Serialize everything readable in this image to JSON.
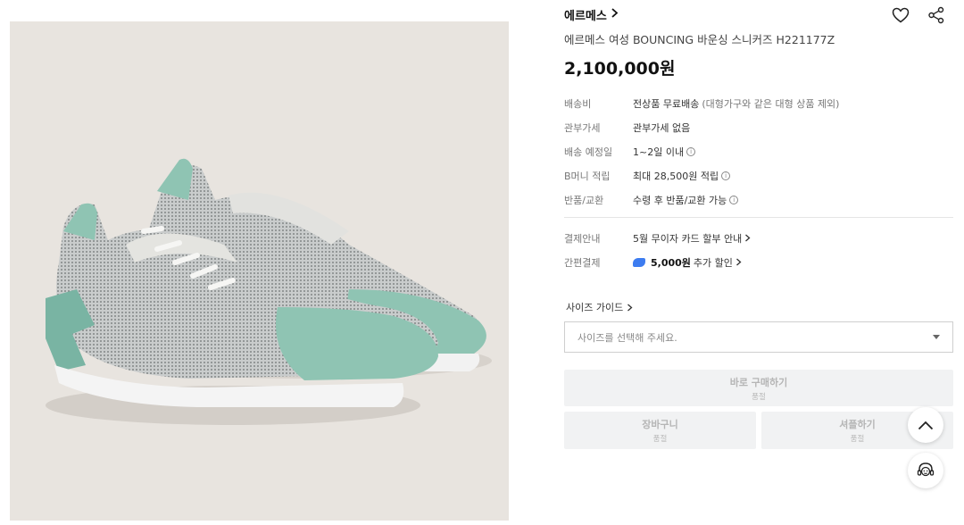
{
  "product": {
    "brand": "에르메스",
    "title": "에르메스 여성 BOUNCING 바운싱 스니커즈 H221177Z",
    "price": "2,100,000원"
  },
  "details": [
    {
      "key": "배송비",
      "value": "전상품 무료배송",
      "sub": "(대형가구와 같은 대형 상품 제외)"
    },
    {
      "key": "관부가세",
      "value": "관부가세 없음"
    },
    {
      "key": "배송 예정일",
      "value": "1~2일 이내"
    },
    {
      "key": "B머니 적립",
      "value": "최대 28,500원 적립"
    },
    {
      "key": "반품/교환",
      "value": "수령 후 반품/교환 가능"
    }
  ],
  "payment": [
    {
      "key": "결제안내",
      "value": "5월 무이자 카드 할부 안내"
    },
    {
      "key": "간편결제",
      "value_bold": "5,000원",
      "value": "추가 할인"
    }
  ],
  "size": {
    "guide_label": "사이즈 가이드",
    "placeholder": "사이즈를 선택해 주세요."
  },
  "buttons": {
    "buy_label": "바로 구매하기",
    "buy_sub": "품절",
    "cart_label": "장바구니",
    "cart_sub": "품절",
    "sample_label": "셔플하기",
    "sample_sub": "품절"
  },
  "colors": {
    "accent_blue": "#3d7cf0",
    "shoe_mint": "#8fc4b3",
    "background_beige": "#e8e4df"
  }
}
